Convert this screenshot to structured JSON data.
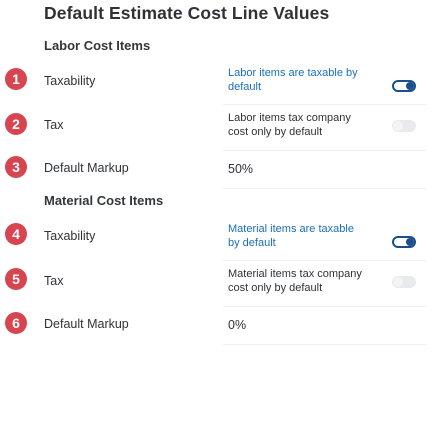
{
  "title": "Default Estimate Cost Line Values",
  "labor": {
    "heading": "Labor Cost Items",
    "rows": [
      {
        "badge": "1",
        "label": "Taxability",
        "value_line1": "Labor items are taxable by",
        "value_line2": "default",
        "toggle": "on"
      },
      {
        "badge": "2",
        "label": "Tax",
        "value_line1": "Labor items tax company",
        "value_line2": "cost only by default",
        "toggle": "off"
      },
      {
        "badge": "3",
        "label": "Default Markup",
        "value": "50%"
      }
    ]
  },
  "material": {
    "heading": "Material Cost Items",
    "rows": [
      {
        "badge": "4",
        "label": "Taxability",
        "value_line1": "Material items are taxable",
        "value_line2": "by default",
        "toggle": "on"
      },
      {
        "badge": "5",
        "label": "Tax",
        "value_line1": "Material items tax company",
        "value_line2": "cost only by default",
        "toggle": "off"
      },
      {
        "badge": "6",
        "label": "Default Markup",
        "value": "0%"
      }
    ]
  },
  "colors": {
    "badge": "#d64550",
    "toggle_on": "#1a4f8b",
    "link_text": "#1a6fb8"
  }
}
